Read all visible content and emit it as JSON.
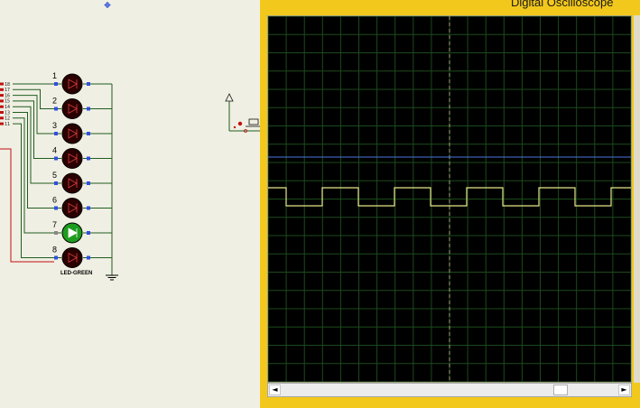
{
  "oscilloscope": {
    "title": "Digital Oscilloscope",
    "channels": [
      {
        "name": "",
        "color": "#4a74e0",
        "kind": "flat"
      },
      {
        "name": "",
        "color": "#e6e68a",
        "kind": "square"
      }
    ],
    "scrollbar": {
      "left_arrow": "◄",
      "right_arrow": "►"
    }
  },
  "schematic": {
    "pin_labels": [
      "18",
      "17",
      "16",
      "15",
      "14",
      "13",
      "12",
      "11"
    ],
    "led_numbers": [
      "1",
      "2",
      "3",
      "4",
      "5",
      "6",
      "7",
      "8"
    ],
    "led_states": [
      "off",
      "off",
      "off",
      "off",
      "off",
      "off",
      "on",
      "off"
    ],
    "led_part_label": "LED-GREEN",
    "colors": {
      "wire": "#1f5e1f",
      "led_off": "#2a0000",
      "led_on": "#1e9c1e",
      "pin_marker": "#3050e0",
      "node": "#c01010"
    }
  }
}
